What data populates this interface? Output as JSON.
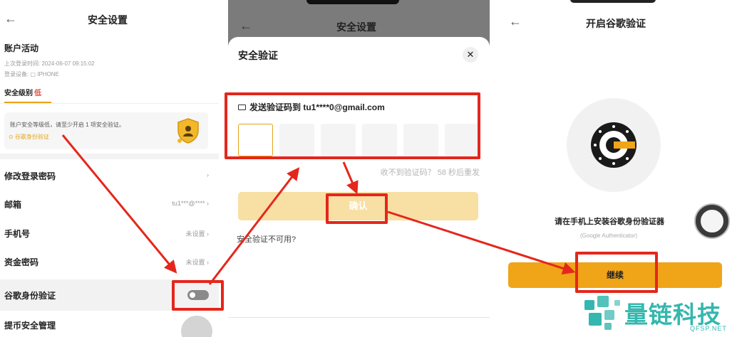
{
  "panel1": {
    "title": "安全设置",
    "account_section": "账户活动",
    "last_login": "上次登录时间: 2024-06-07 09:15:02",
    "login_device": "登录设备: ▢ IPHONE",
    "security_level_label": "安全级别",
    "security_level_value": "低",
    "notice_text": "账户安全等级低，请至少开启 1 项安全验证。",
    "notice_link": "⊙ 谷歌身份验证",
    "rows": [
      {
        "label": "修改登录密码",
        "value": "›"
      },
      {
        "label": "邮箱",
        "value": "tu1***@**** ›"
      },
      {
        "label": "手机号",
        "value": "未设置 ›"
      },
      {
        "label": "资金密码",
        "value": "未设置 ›"
      },
      {
        "label": "谷歌身份验证",
        "value": ""
      },
      {
        "label": "提币安全管理",
        "value": ""
      }
    ]
  },
  "panel2": {
    "bg_title": "安全设置",
    "sheet_title": "安全验证",
    "close_label": "✕",
    "send_code": "发送验证码到 tu1****0@gmail.com",
    "resend": "收不到验证码？ 58 秒后重发",
    "confirm": "确认",
    "unavailable": "安全验证不可用?"
  },
  "panel3": {
    "title": "开启谷歌验证",
    "install_text": "请在手机上安装谷歌身份验证器",
    "install_sub": "(Google Authenticator)",
    "continue": "继续"
  },
  "brand": {
    "name": "量链科技",
    "url": "QFSP.NET"
  },
  "colors": {
    "accent": "#f0a418",
    "highlight": "#e5261c",
    "warning": "#e24a3b",
    "brand": "#34b7ae"
  },
  "icons": [
    "back-arrow-icon",
    "chevron-right-icon",
    "shield-user-icon",
    "mail-icon",
    "close-icon",
    "google-authenticator-icon",
    "toggle-switch"
  ]
}
